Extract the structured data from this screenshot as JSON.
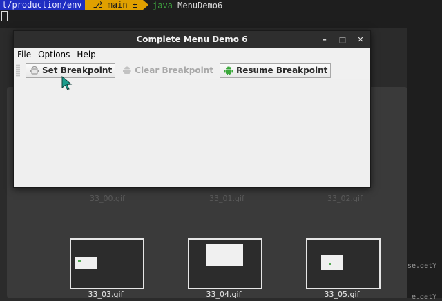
{
  "terminal": {
    "path": "t/production/env",
    "branch": "⎇ main ±",
    "command_kw": "java",
    "command_arg": "MenuDemo6"
  },
  "browser": {
    "thumbnails": [
      {
        "label": "33_03.gif"
      },
      {
        "label": "33_04.gif"
      },
      {
        "label": "33_05.gif"
      }
    ],
    "faint_labels": [
      "33_00.gif",
      "33_01.gif",
      "33_02.gif"
    ]
  },
  "side_code": {
    "line1": "se.getY",
    "line2": "e.getY"
  },
  "window": {
    "title": "Complete Menu Demo 6",
    "controls": {
      "minimize": "–",
      "maximize": "□",
      "close": "✕"
    },
    "menu": [
      {
        "label": "File"
      },
      {
        "label": "Options"
      },
      {
        "label": "Help"
      }
    ],
    "toolbar": {
      "set_breakpoint": "Set Breakpoint",
      "clear_breakpoint": "Clear Breakpoint",
      "resume_breakpoint": "Resume Breakpoint"
    }
  },
  "colors": {
    "path_segment": "#1f2ec2",
    "branch_segment": "#e0a000",
    "android_green": "#3aa83a",
    "cursor_teal": "#1a9c8c"
  }
}
